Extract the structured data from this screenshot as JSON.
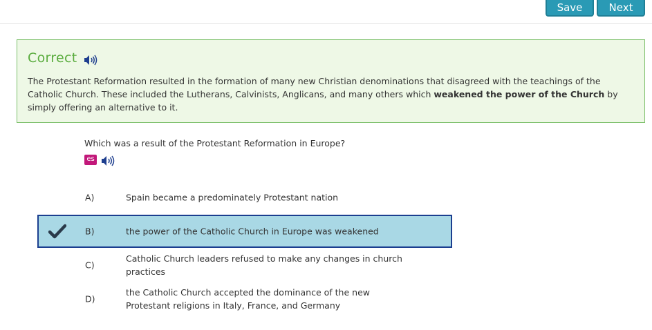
{
  "toolbar": {
    "save_label": "Save",
    "next_label": "Next"
  },
  "feedback": {
    "title": "Correct",
    "text_before": "The Protestant Reformation resulted in the formation of many new Christian denominations that disagreed with the teachings of the Catholic Church. These included the Lutherans, Calvinists, Anglicans, and many others which ",
    "text_bold": "weakened the power of the Church",
    "text_after": " by simply offering an alternative to it.",
    "accent_color": "#5aac3e"
  },
  "question": {
    "text": "Which was a result of the Protestant Reformation in Europe?",
    "language_icon": "es",
    "audio_icon": "speaker-icon"
  },
  "options": [
    {
      "letter": "A)",
      "text": "Spain became a predominately Protestant nation",
      "selected": false
    },
    {
      "letter": "B)",
      "text": "the power of the Catholic Church in Europe was weakened",
      "selected": true
    },
    {
      "letter": "C)",
      "text": "Catholic Church leaders refused to make any changes in church practices",
      "selected": false
    },
    {
      "letter": "D)",
      "text": "the Catholic Church accepted the dominance of the new Protestant religions in Italy, France, and Germany",
      "selected": false
    }
  ],
  "colors": {
    "button": "#2a9ab5",
    "selected_bg": "#a9d8e5",
    "selected_border": "#1b3e8f",
    "es_badge": "#c2187a"
  }
}
